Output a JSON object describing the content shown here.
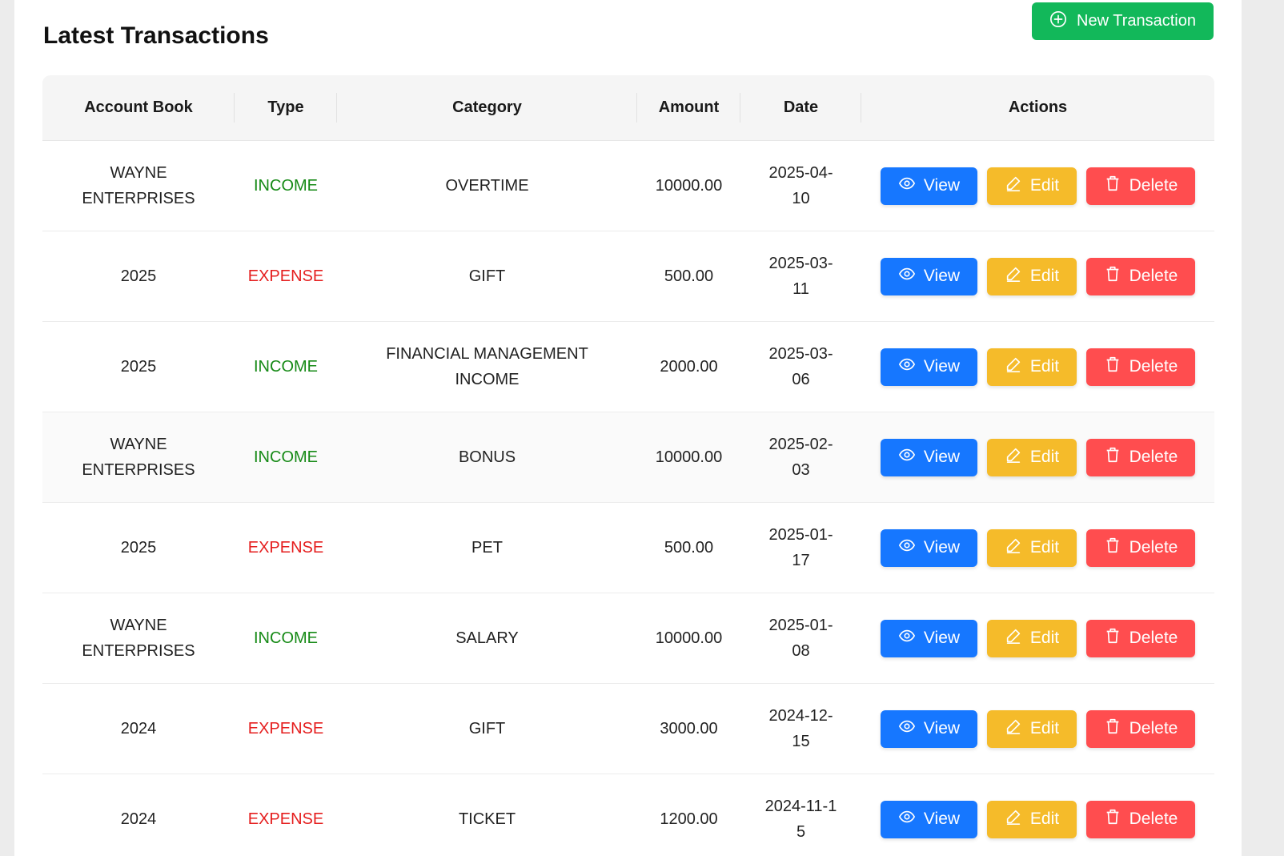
{
  "header": {
    "title": "Latest Transactions",
    "new_button_label": "New Transaction"
  },
  "table": {
    "columns": [
      "Account Book",
      "Type",
      "Category",
      "Amount",
      "Date",
      "Actions"
    ],
    "action_labels": {
      "view": "View",
      "edit": "Edit",
      "delete": "Delete"
    },
    "rows": [
      {
        "account_book": "WAYNE ENTERPRISES",
        "type": "INCOME",
        "category": "OVERTIME",
        "amount": "10000.00",
        "date": "2025-04-10"
      },
      {
        "account_book": "2025",
        "type": "EXPENSE",
        "category": "GIFT",
        "amount": "500.00",
        "date": "2025-03-11"
      },
      {
        "account_book": "2025",
        "type": "INCOME",
        "category": "FINANCIAL MANAGEMENT INCOME",
        "amount": "2000.00",
        "date": "2025-03-06"
      },
      {
        "account_book": "WAYNE ENTERPRISES",
        "type": "INCOME",
        "category": "BONUS",
        "amount": "10000.00",
        "date": "2025-02-03"
      },
      {
        "account_book": "2025",
        "type": "EXPENSE",
        "category": "PET",
        "amount": "500.00",
        "date": "2025-01-17"
      },
      {
        "account_book": "WAYNE ENTERPRISES",
        "type": "INCOME",
        "category": "SALARY",
        "amount": "10000.00",
        "date": "2025-01-08"
      },
      {
        "account_book": "2024",
        "type": "EXPENSE",
        "category": "GIFT",
        "amount": "3000.00",
        "date": "2024-12-15"
      },
      {
        "account_book": "2024",
        "type": "EXPENSE",
        "category": "TICKET",
        "amount": "1200.00",
        "date": "2024-11-15"
      }
    ]
  },
  "colors": {
    "new_button": "#12b85a",
    "view_button": "#1677ff",
    "edit_button": "#f5bb2a",
    "delete_button": "#ff4d4f",
    "income_text": "#168a16",
    "expense_text": "#e51e1e"
  },
  "icons": {
    "new_button": "plus-circle-icon",
    "view": "eye-icon",
    "edit": "pencil-icon",
    "delete": "trash-icon"
  }
}
